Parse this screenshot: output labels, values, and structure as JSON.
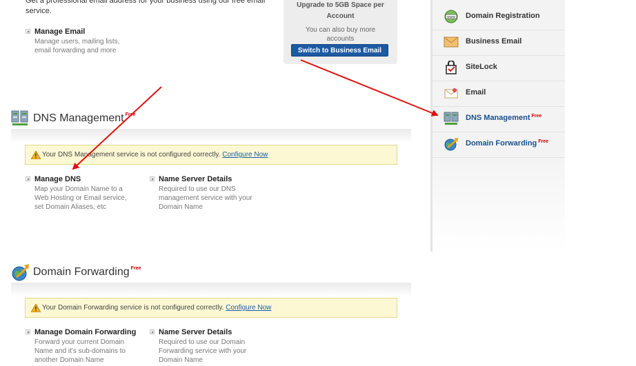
{
  "email": {
    "intro": "Get a professional email address for your business using our free email service.",
    "manage_title": "Manage Email",
    "manage_desc": "Manage users, mailing lists, email forwarding and more"
  },
  "upgrade": {
    "title": "Upgrade to 5GB Space per Account",
    "subtitle": "You can also buy more accounts",
    "button": "Switch to Business Email"
  },
  "dns": {
    "title": "DNS Management",
    "free_badge": "Free",
    "warning": "Your DNS Management service is not configured correctly.",
    "configure_link": "Configure Now",
    "links": [
      {
        "title": "Manage DNS",
        "desc": "Map your Domain Name to a Web Hosting or Email service, set Domain Aliases, etc"
      },
      {
        "title": "Name Server Details",
        "desc": "Required to use our DNS management service with your Domain Name"
      }
    ]
  },
  "forwarding": {
    "title": "Domain Forwarding",
    "free_badge": "Free",
    "warning": "Your Domain Forwarding service is not configured correctly.",
    "configure_link": "Configure Now",
    "links": [
      {
        "title": "Manage Domain Forwarding",
        "desc": "Forward your current Domain Name and it's sub-domains to another Domain Name"
      },
      {
        "title": "Name Server Details",
        "desc": "Required to use our Domain Forwarding service with your Domain Name"
      }
    ]
  },
  "sidebar": {
    "items": [
      {
        "label": "Domain Registration",
        "icon": "domain-registration-icon"
      },
      {
        "label": "Business Email",
        "icon": "envelope-icon"
      },
      {
        "label": "SiteLock",
        "icon": "sitelock-icon"
      },
      {
        "label": "Email",
        "icon": "email-icon"
      },
      {
        "label": "DNS Management",
        "icon": "server-icon",
        "badge": "Free"
      },
      {
        "label": "Domain Forwarding",
        "icon": "globe-arrow-icon",
        "badge": "Free"
      }
    ]
  },
  "colors": {
    "annotation_arrow": "#e01010",
    "link_blue": "#1a5ba6",
    "badge_red": "#cc0000"
  }
}
